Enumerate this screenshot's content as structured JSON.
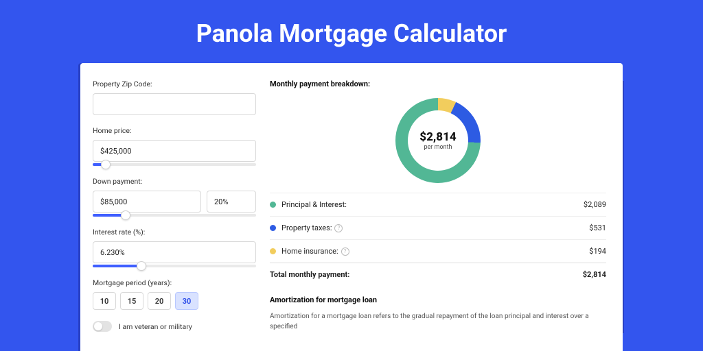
{
  "title": "Panola Mortgage Calculator",
  "form": {
    "zip": {
      "label": "Property Zip Code:",
      "value": ""
    },
    "price": {
      "label": "Home price:",
      "value": "$425,000",
      "slider_pct": 8
    },
    "down": {
      "label": "Down payment:",
      "value": "$85,000",
      "pct_value": "20%",
      "slider_pct": 20
    },
    "rate": {
      "label": "Interest rate (%):",
      "value": "6.230%",
      "slider_pct": 30
    },
    "period": {
      "label": "Mortgage period (years):",
      "options": [
        "10",
        "15",
        "20",
        "30"
      ],
      "active": "30"
    },
    "veteran": {
      "label": "I am veteran or military"
    }
  },
  "breakdown": {
    "heading": "Monthly payment breakdown:",
    "center_amount": "$2,814",
    "center_sub": "per month",
    "items": [
      {
        "label": "Principal & Interest:",
        "value": "$2,089",
        "color": "#52b795",
        "has_help": false
      },
      {
        "label": "Property taxes:",
        "value": "$531",
        "color": "#2d5be3",
        "has_help": true
      },
      {
        "label": "Home insurance:",
        "value": "$194",
        "color": "#f2cd5d",
        "has_help": true
      }
    ],
    "total": {
      "label": "Total monthly payment:",
      "value": "$2,814"
    }
  },
  "amort": {
    "heading": "Amortization for mortgage loan",
    "body": "Amortization for a mortgage loan refers to the gradual repayment of the loan principal and interest over a specified"
  },
  "chart_data": {
    "type": "pie",
    "title": "Monthly payment breakdown",
    "categories": [
      "Principal & Interest",
      "Property taxes",
      "Home insurance"
    ],
    "values": [
      2089,
      531,
      194
    ],
    "colors": [
      "#52b795",
      "#2d5be3",
      "#f2cd5d"
    ],
    "total": 2814
  }
}
